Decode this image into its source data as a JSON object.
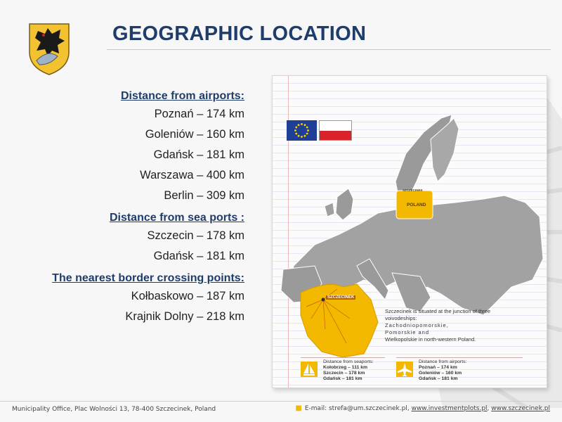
{
  "slide": {
    "title": "GEOGRAPHIC LOCATION"
  },
  "airports": {
    "heading": "Distance from airports:",
    "items": [
      "Poznań – 174 km",
      "Goleniów – 160 km",
      "Gdańsk – 181 km",
      "Warszawa – 400 km",
      "Berlin – 309 km"
    ]
  },
  "seaports": {
    "heading": "Distance from sea ports :",
    "items": [
      "Szczecin – 178 km",
      "Gdańsk – 181 km"
    ]
  },
  "border": {
    "heading": "The nearest border crossing points:",
    "items": [
      "Kołbaskowo – 187 km",
      "Krajnik Dolny – 218 km"
    ]
  },
  "map": {
    "europe_poland_label": "POLAND",
    "city_label": "SZCZECINEK",
    "info_lines": [
      "Szczecinek is situated at the junction of three",
      "voivodeships:",
      "Zachodniopomorskie,",
      "Pomorskie and",
      "Wielkopolskie in north-western Poland."
    ],
    "seaports_legend": {
      "title": "Distance from seaports:",
      "lines": [
        "Kołobrzeg – 111 km",
        "Szczecin – 178 km",
        "Gdańsk – 181 km"
      ]
    },
    "airports_legend": {
      "title": "Distance from airports:",
      "lines": [
        "Poznań – 174 km",
        "Goleniów – 160 km",
        "Gdańsk – 181 km"
      ]
    },
    "colors": {
      "poland": "#f3b800",
      "europe": "#9a9a9a",
      "eu_blue": "#1f3e96",
      "pl_red": "#d8232a"
    }
  },
  "footer": {
    "address": "Municipality Office, Plac Wolności 13, 78-400 Szczecinek, Poland",
    "email_prefix": "E-mail: strefa@um.szczecinek.pl,",
    "link1": "www.investmentplots.pl",
    "separator": ",",
    "link2": "www.szczecinek.pl"
  },
  "icons": [
    "coat-of-arms-icon",
    "eu-flag-icon",
    "poland-flag-icon",
    "sailboat-icon",
    "airplane-icon",
    "eagle-watermark-icon"
  ]
}
